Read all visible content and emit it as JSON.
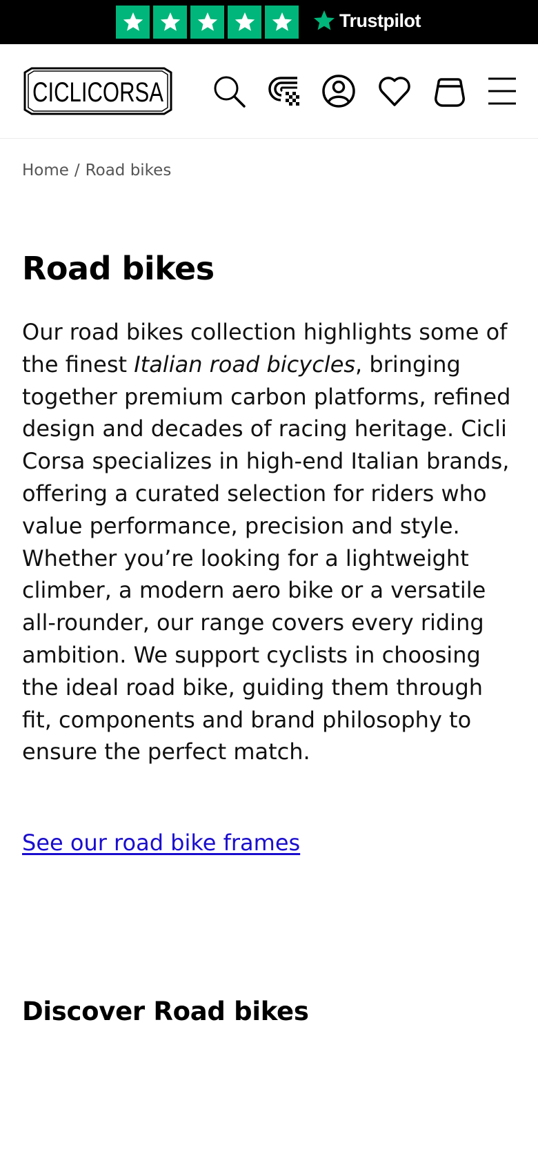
{
  "trustbar": {
    "rating_stars": 5,
    "brand": "Trustpilot",
    "star_color": "#00b67a"
  },
  "header": {
    "logo_text": "CICLICORSA",
    "icons": [
      "search-icon",
      "loyalty-icon",
      "account-icon",
      "wishlist-icon",
      "cart-icon",
      "menu-icon"
    ]
  },
  "breadcrumb": {
    "home": "Home",
    "separator": "/",
    "current": "Road bikes"
  },
  "main": {
    "title": "Road bikes",
    "description_part1": "Our road bikes collection highlights some of the finest ",
    "description_italic": "Italian road bicycles",
    "description_part2": ", bringing together premium carbon platforms, refined design and decades of racing heritage. Cicli Corsa specializes in high-end Italian brands, offering a curated selection for riders who value performance, precision and style. Whether you’re looking for a lightweight climber, a modern aero bike or a versatile all-rounder, our range covers every riding ambition. We support cyclists in choosing the ideal road bike, guiding them through fit, components and brand philosophy to ensure the perfect match.",
    "frames_link": "See our road bike frames",
    "link_color": "#1a0dce"
  },
  "discover": {
    "heading": "Discover Road bikes"
  }
}
